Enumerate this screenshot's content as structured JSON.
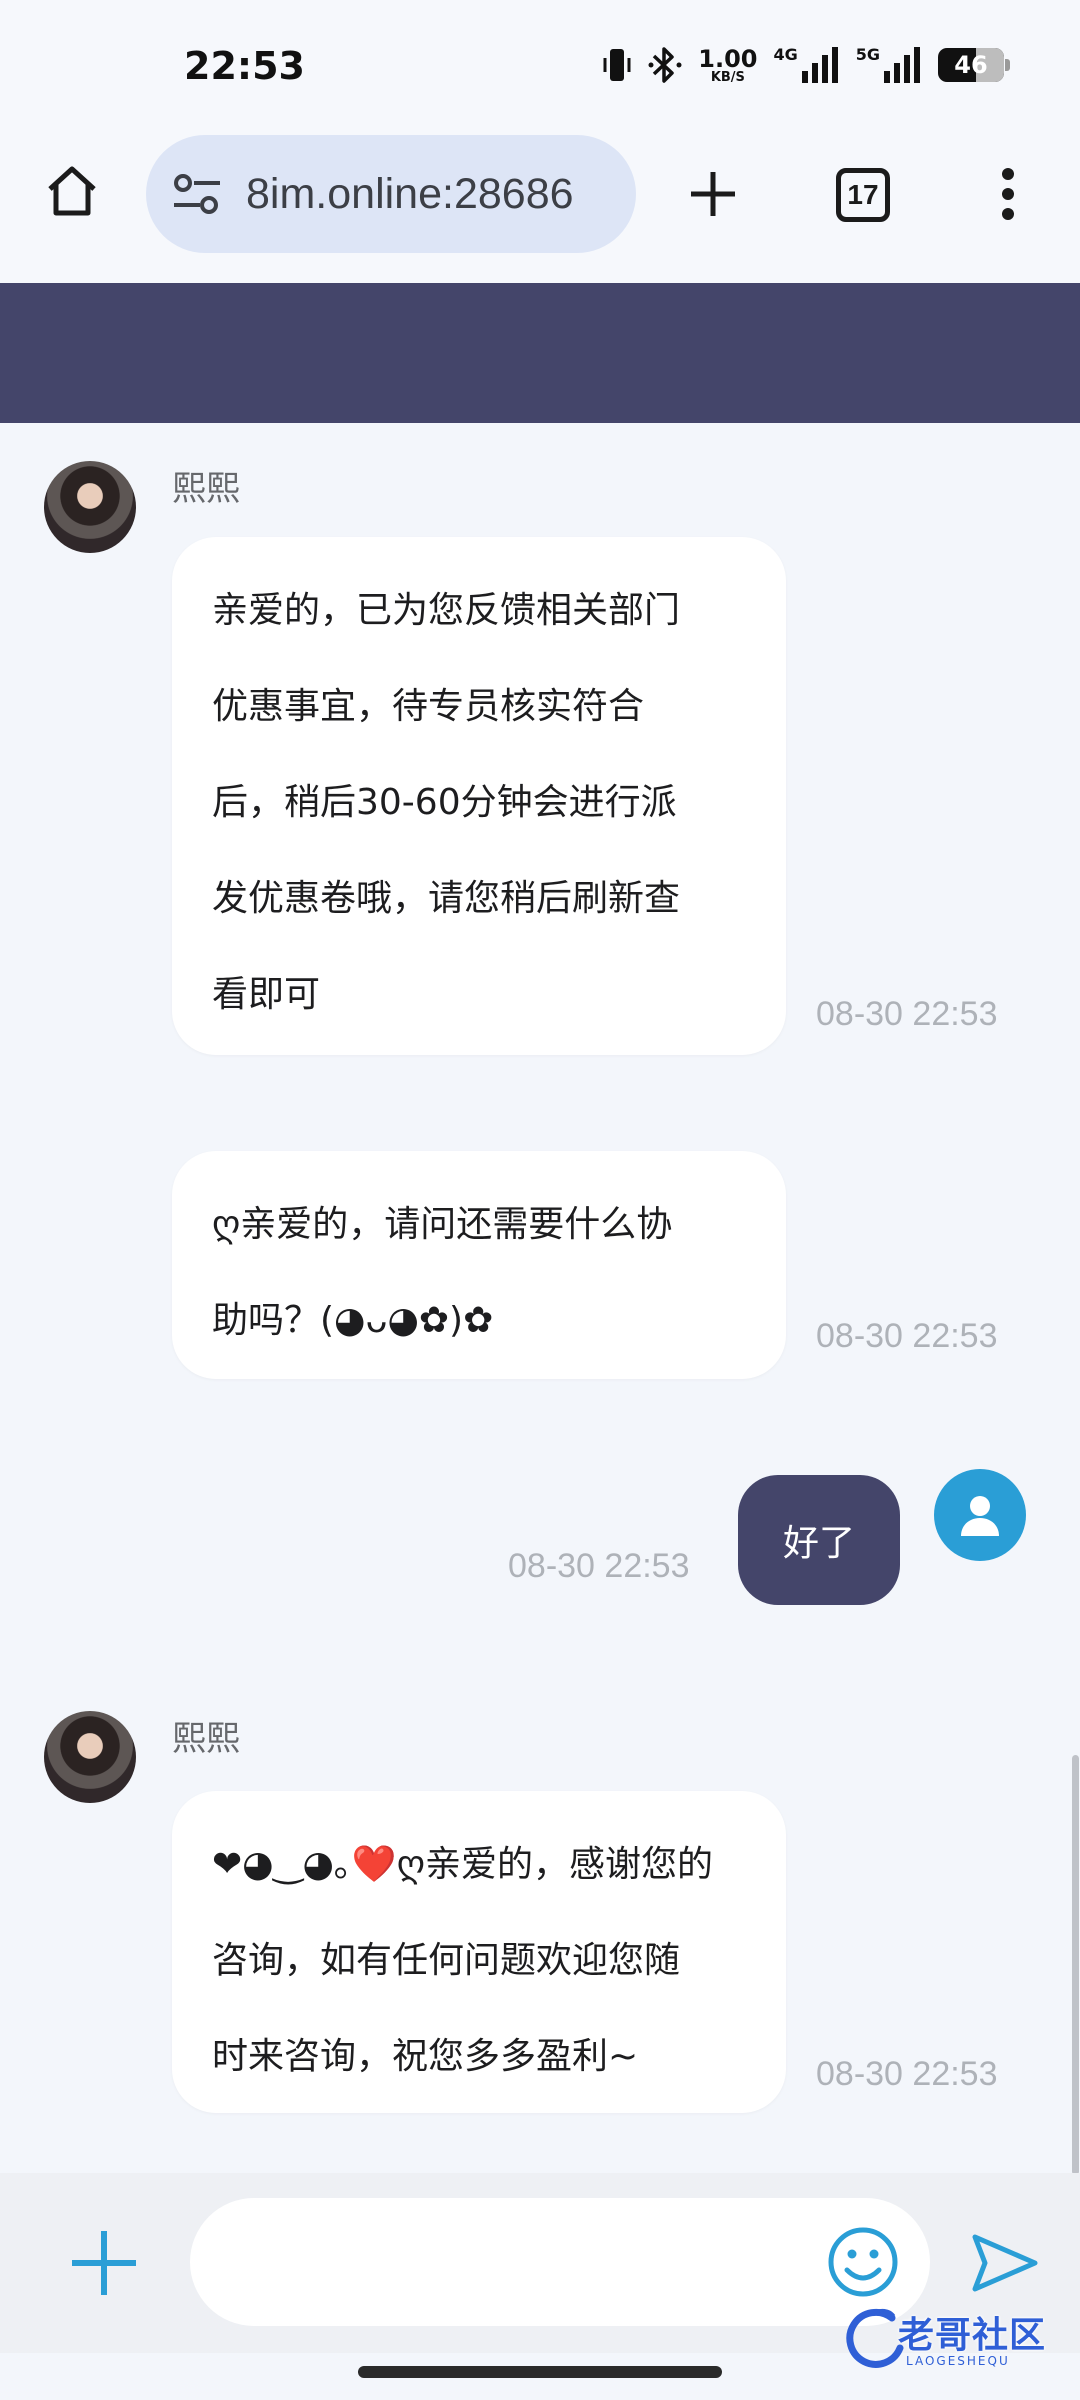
{
  "status_bar": {
    "time": "22:53",
    "net_speed_value": "1.00",
    "net_speed_unit": "KB/S",
    "signal1_label": "4G",
    "signal2_label": "5G",
    "battery": "46",
    "icons": [
      "vibrate-icon",
      "bluetooth-icon",
      "signal-icon",
      "signal-icon",
      "battery-icon"
    ]
  },
  "browser": {
    "url": "8im.online:28686",
    "tab_count": "17",
    "icons": [
      "home-icon",
      "site-settings-icon",
      "plus-icon",
      "tabs-icon",
      "more-vert-icon"
    ]
  },
  "chat": {
    "header_color": "#44456a",
    "messages": [
      {
        "side": "incoming",
        "sender": "熙熙",
        "lines": [
          "亲爱的，已为您反馈相关部门",
          "优惠事宜，待专员核实符合",
          "后，稍后30-60分钟会进行派",
          "发优惠卷哦，请您稍后刷新查",
          "看即可"
        ],
        "time": "08-30 22:53"
      },
      {
        "side": "incoming",
        "lines": [
          "ღ亲爱的，请问还需要什么协",
          "助吗？(◕ᴗ◕✿)✿"
        ],
        "time": "08-30 22:53"
      },
      {
        "side": "outgoing",
        "text": "好了",
        "time": "08-30 22:53"
      },
      {
        "side": "incoming",
        "sender": "熙熙",
        "lines": [
          "❤◕‿◕｡❤️ღ亲爱的，感谢您的",
          "咨询，如有任何问题欢迎您随",
          "时来咨询，祝您多多盈利~"
        ],
        "time": "08-30 22:53"
      }
    ]
  },
  "input_bar": {
    "placeholder": "",
    "icons": [
      "plus-icon",
      "emoji-icon",
      "send-icon"
    ],
    "accent_color": "#2a9ed6"
  },
  "watermark": {
    "text": "老哥社区",
    "sub": "LAOGESHEQU"
  }
}
